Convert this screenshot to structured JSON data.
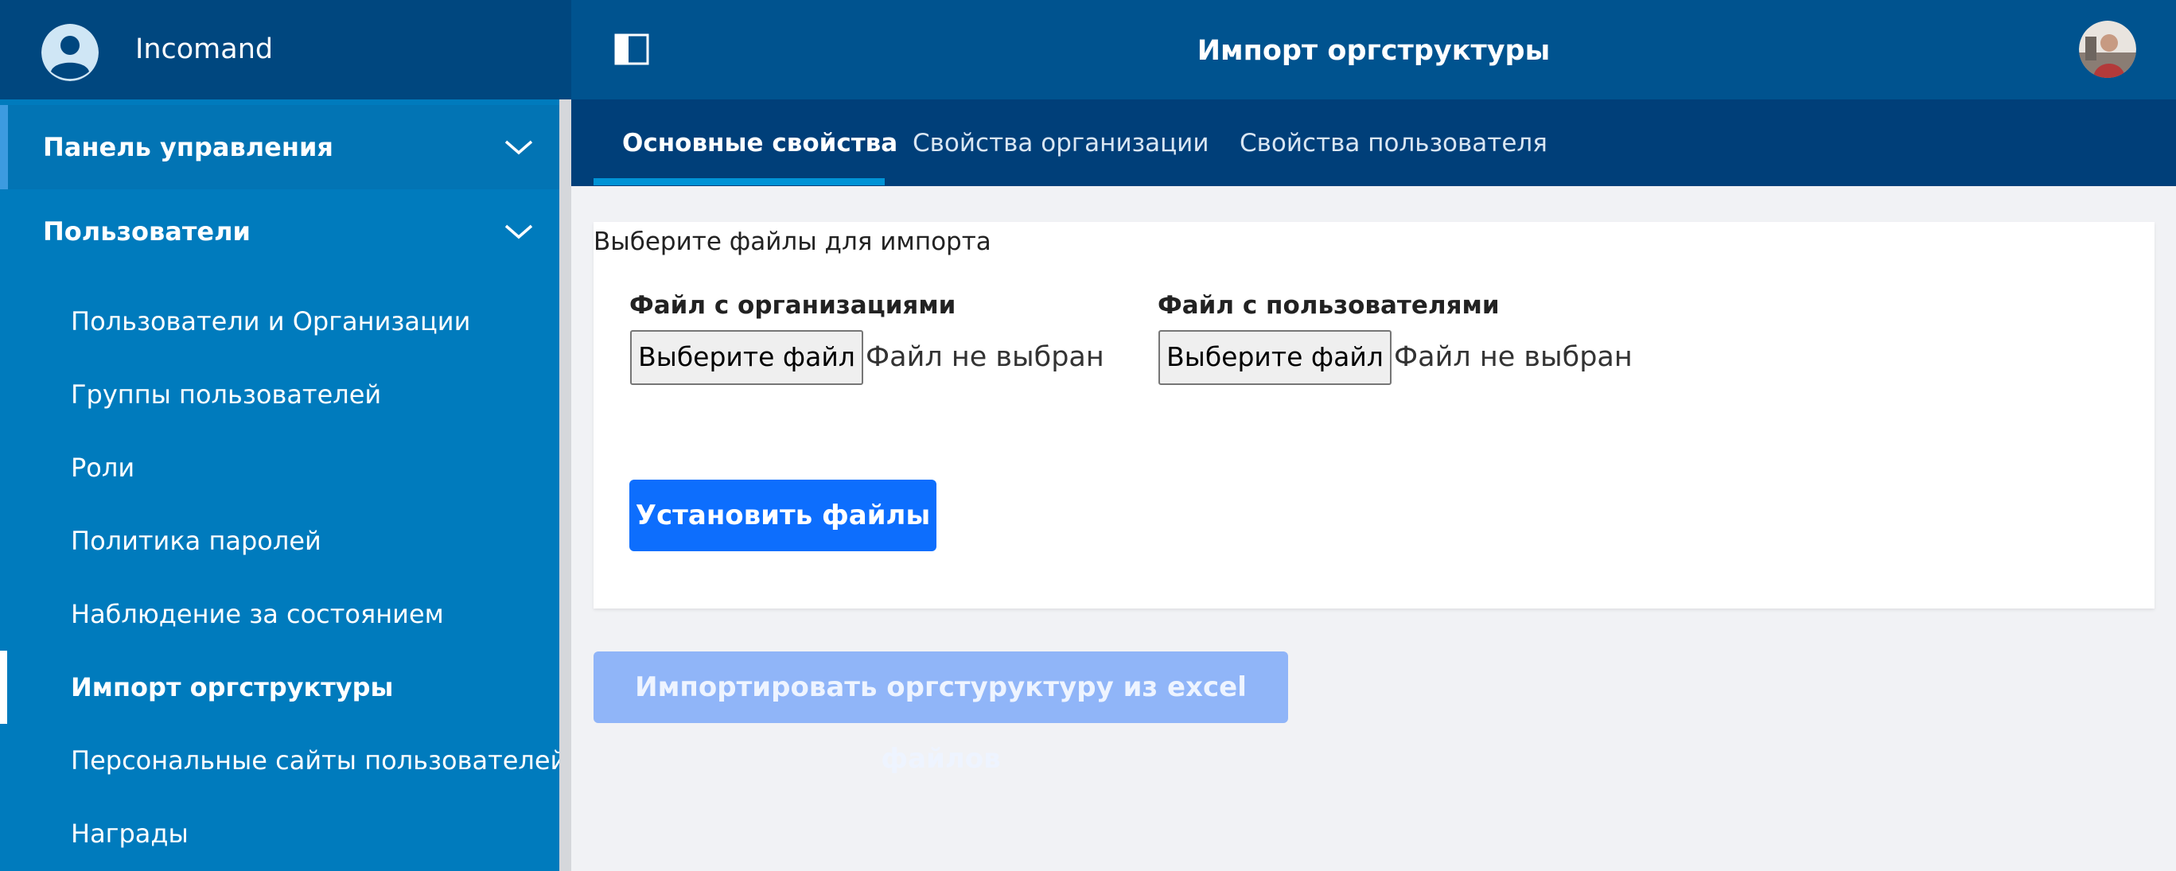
{
  "app": {
    "brand": "Incomand",
    "page_title": "Импорт оргструктуры"
  },
  "sidebar": {
    "groups": [
      {
        "label": "Панель управления"
      },
      {
        "label": "Пользователи"
      }
    ],
    "items": [
      {
        "label": "Пользователи и Организации"
      },
      {
        "label": "Группы пользователей"
      },
      {
        "label": "Роли"
      },
      {
        "label": "Политика паролей"
      },
      {
        "label": "Наблюдение за состоянием"
      },
      {
        "label": "Импорт оргструктуры"
      },
      {
        "label": "Персональные сайты пользователей"
      },
      {
        "label": "Награды"
      }
    ]
  },
  "tabs": [
    {
      "label": "Основные свойства"
    },
    {
      "label": "Свойства организации"
    },
    {
      "label": "Свойства пользователя"
    }
  ],
  "form": {
    "title": "Выберите файлы для импорта",
    "org_file": {
      "label": "Файл с организациями",
      "button": "Выберите файл",
      "status": "Файл не выбран"
    },
    "user_file": {
      "label": "Файл с пользователями",
      "button": "Выберите файл",
      "status": "Файл не выбран"
    },
    "submit_label": "Установить файлы"
  },
  "import_label": "Импортировать оргстуруктуру из excel файлов",
  "colors": {
    "sidebar": "#007bbd",
    "sidebar_header": "#00477f",
    "topbar": "#00538f",
    "tabbar": "#003f79",
    "primary": "#0d6efd",
    "disabled_primary": "#90b5f8"
  }
}
